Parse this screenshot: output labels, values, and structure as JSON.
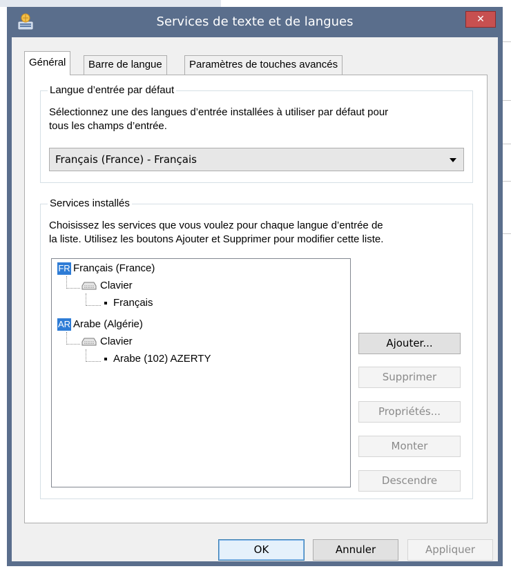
{
  "window": {
    "title": "Services de texte et de langues",
    "close_label": "✕"
  },
  "tabs": [
    {
      "label": "Général",
      "active": true
    },
    {
      "label": "Barre de langue",
      "active": false
    },
    {
      "label": "Paramètres de touches avancés",
      "active": false
    }
  ],
  "default_language": {
    "group_label": "Langue d’entrée par défaut",
    "description_line1": "Sélectionnez une des langues d’entrée installées à utiliser par défaut pour",
    "description_line2": "tous les champs d’entrée.",
    "selected_value": "Français (France) - Français"
  },
  "installed_services": {
    "group_label": "Services installés",
    "description_line1": "Choisissez les services que vous voulez pour chaque langue d’entrée de",
    "description_line2": "la liste. Utilisez les boutons Ajouter et Supprimer pour modifier cette liste.",
    "tree": [
      {
        "badge": "FR",
        "language": "Français (France)",
        "category": "Clavier",
        "layout": "Français"
      },
      {
        "badge": "AR",
        "language": "Arabe (Algérie)",
        "category": "Clavier",
        "layout": "Arabe (102) AZERTY"
      }
    ],
    "buttons": {
      "add": "Ajouter...",
      "remove": "Supprimer",
      "properties": "Propriétés...",
      "move_up": "Monter",
      "move_down": "Descendre"
    }
  },
  "footer": {
    "ok": "OK",
    "cancel": "Annuler",
    "apply": "Appliquer"
  },
  "colors": {
    "titlebar": "#5a6e8c",
    "close_button": "#c75050",
    "language_badge": "#2e7cd6"
  }
}
